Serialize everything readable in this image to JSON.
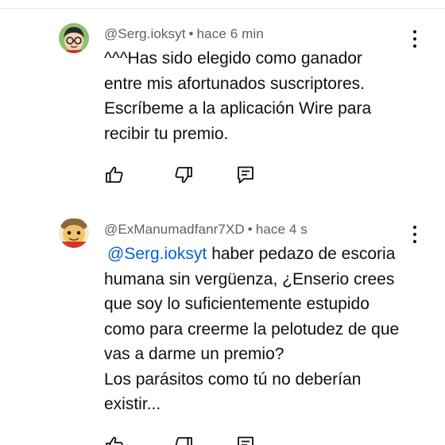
{
  "comments": [
    {
      "author": "@Serg.ioksyt",
      "separator": "•",
      "time": "hace 6 min",
      "lines": [
        "^^^Has sido elegido como ganador",
        "entre mis afortunados suscriptores.",
        "Escríbeme a la aplicación Wire para",
        "recibir tu premio."
      ],
      "actions": [
        "like-icon",
        "dislike-icon",
        "reply-icon"
      ],
      "menu_icon": "more-vert-icon"
    },
    {
      "author": "@ExManumadfanr7XD",
      "separator": "•",
      "time": "hace 4 s",
      "mention": "@Serg.ioksyt",
      "first_line_rest": "haber pedazo de escoria",
      "lines": [
        "humana sin vergüenza, ¿Enserio crees",
        "que soy lo suficientemente estupido",
        "como para creerme la pelotudez de que",
        "vas a darme un premio?",
        "Los parásitos como tú no deberían",
        "existir..."
      ],
      "actions": [
        "like-icon",
        "dislike-icon",
        "reply-icon"
      ],
      "menu_icon": "more-vert-icon"
    }
  ],
  "colors": {
    "mention": "#065fd4",
    "meta": "#606060",
    "text": "#0f0f0f"
  }
}
